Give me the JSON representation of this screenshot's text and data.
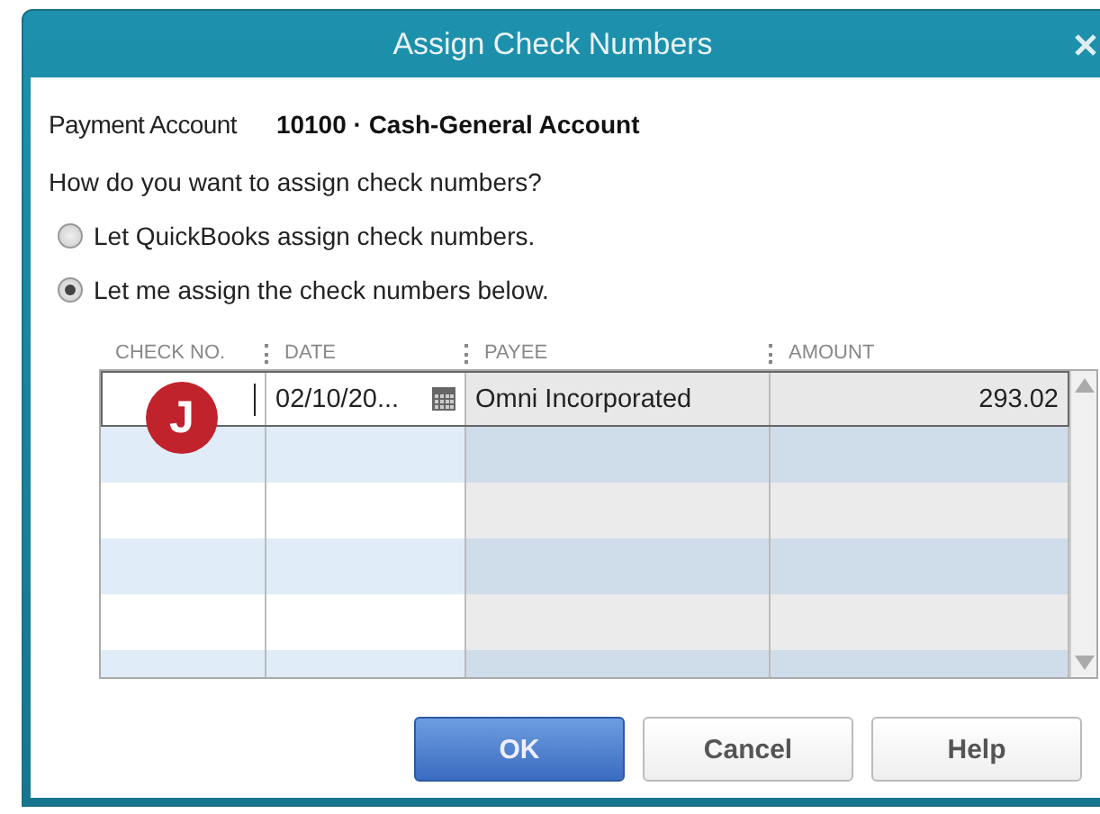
{
  "window": {
    "title": "Assign Check Numbers"
  },
  "payment_account": {
    "label": "Payment Account",
    "value": "10100 · Cash-General Account"
  },
  "question": "How do you want to assign check numbers?",
  "options": [
    {
      "label": "Let QuickBooks assign check numbers.",
      "selected": false
    },
    {
      "label": "Let me assign the check numbers below.",
      "selected": true
    }
  ],
  "table": {
    "columns": [
      "CHECK NO.",
      "DATE",
      "PAYEE",
      "AMOUNT"
    ],
    "rows": [
      {
        "check_no": "",
        "date": "02/10/20...",
        "payee": "Omni Incorporated",
        "amount": "293.02",
        "selected": true
      }
    ]
  },
  "callout": "J",
  "buttons": [
    {
      "label": "OK",
      "kind": "primary"
    },
    {
      "label": "Cancel",
      "kind": "normal"
    },
    {
      "label": "Help",
      "kind": "normal"
    }
  ]
}
